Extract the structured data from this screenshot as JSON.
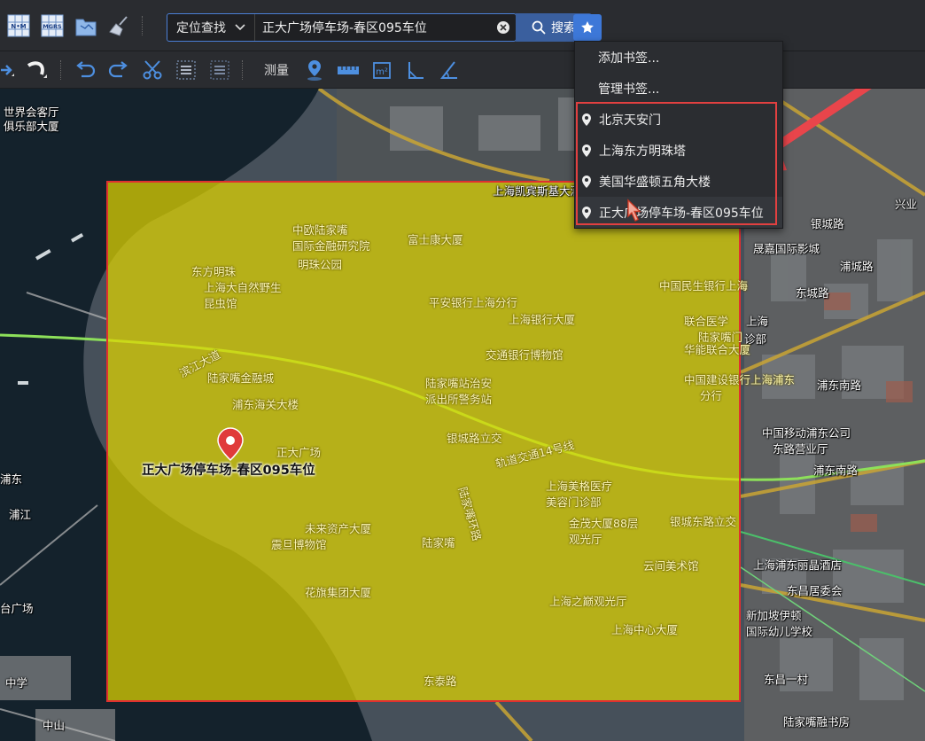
{
  "toolbar_top": {
    "icons": [
      "nm-grid-icon",
      "mgrs-grid-icon",
      "folder-map-icon",
      "broom-clear-icon"
    ],
    "search_mode": "定位查找",
    "search_value": "正大广场停车场-春区095车位",
    "search_button": "搜索",
    "bookmark_icon": "star-icon"
  },
  "toolbar_bottom": {
    "icons": [
      "arrow-right-icon",
      "curve-icon",
      "undo-icon",
      "redo-icon",
      "scissors-icon",
      "select-box-icon",
      "select-box-alt-icon"
    ],
    "measure_label": "测量",
    "measure_icons": [
      "location-measure-icon",
      "distance-icon",
      "area-icon",
      "height-icon",
      "angle-icon"
    ]
  },
  "bookmark_menu": {
    "add_label": "添加书签...",
    "manage_label": "管理书签...",
    "bookmarks": [
      "北京天安门",
      "上海东方明珠塔",
      "美国华盛顿五角大楼",
      "正大广场停车场-春区095车位"
    ]
  },
  "map": {
    "marker_caption": "正大广场停车场-春区095车位",
    "colors": {
      "highlight_fill": "#e2d600",
      "highlight_border": "#e03030",
      "annotation_arrow": "#e8454b",
      "marker": "#e03a3a",
      "accent": "#3d78d8"
    },
    "labels_outside": [
      {
        "text": "世界会客厅",
        "icon": true
      },
      {
        "text": "俱乐部大厦"
      },
      {
        "text": "上海凯宾斯基大酒店",
        "icon": true
      },
      {
        "text": "兴业",
        "icon": true
      },
      {
        "text": "银城路"
      },
      {
        "text": "晟嘉国际影城",
        "icon": true
      },
      {
        "text": "浦城路"
      },
      {
        "text": "东城路"
      },
      {
        "text": "上海"
      },
      {
        "text": "诊部"
      },
      {
        "text": "浦东南路"
      },
      {
        "text": "中国移动浦东公司",
        "icon": true
      },
      {
        "text": "东路营业厅"
      },
      {
        "text": "浦东南路"
      },
      {
        "text": "上海浦东丽晶酒店",
        "icon": true
      },
      {
        "text": "东昌居委会",
        "icon": true
      },
      {
        "text": "新加坡伊顿"
      },
      {
        "text": "国际幼儿学校",
        "icon": true
      },
      {
        "text": "东昌一村"
      },
      {
        "text": "陆家嘴融书房",
        "icon": true
      },
      {
        "text": "台广场"
      },
      {
        "text": "中学"
      },
      {
        "text": "中山"
      },
      {
        "text": "浦东"
      },
      {
        "text": "浦江"
      }
    ],
    "labels_inside": [
      {
        "text": "中欧陆家嘴"
      },
      {
        "text": "国际金融研究院",
        "icon": true
      },
      {
        "text": "明珠公园"
      },
      {
        "text": "富士康大厦",
        "icon": true
      },
      {
        "text": "东方明珠"
      },
      {
        "text": "上海大自然野生"
      },
      {
        "text": "昆虫馆"
      },
      {
        "text": "平安银行上海分行"
      },
      {
        "text": "上海银行大厦",
        "icon": true
      },
      {
        "text": "中国民生银行上海"
      },
      {
        "text": "联合医学",
        "icon": true
      },
      {
        "text": "陆家嘴门"
      },
      {
        "text": "华能联合大厦",
        "icon": true
      },
      {
        "text": "交通银行博物馆"
      },
      {
        "text": "陆家嘴金融城"
      },
      {
        "text": "浦东海关大楼",
        "icon": true
      },
      {
        "text": "陆家嘴站治安"
      },
      {
        "text": "派出所警务站"
      },
      {
        "text": "中国建设银行上海浦东"
      },
      {
        "text": "分行"
      },
      {
        "text": "正大广场"
      },
      {
        "text": "银城路立交"
      },
      {
        "text": "轨道交通14号线"
      },
      {
        "text": "上海美格医疗"
      },
      {
        "text": "美容门诊部"
      },
      {
        "text": "金茂大厦88层"
      },
      {
        "text": "观光厅"
      },
      {
        "text": "银城东路立交"
      },
      {
        "text": "未来资产大厦",
        "icon": true
      },
      {
        "text": "震旦博物馆",
        "icon": true
      },
      {
        "text": "陆家嘴"
      },
      {
        "text": "云间美术馆"
      },
      {
        "text": "花旗集团大厦",
        "icon": true
      },
      {
        "text": "上海之巅观光厅"
      },
      {
        "text": "滨江大道"
      },
      {
        "text": "陆家嘴环路"
      },
      {
        "text": "上海中心大厦"
      },
      {
        "text": "东泰路"
      }
    ]
  }
}
